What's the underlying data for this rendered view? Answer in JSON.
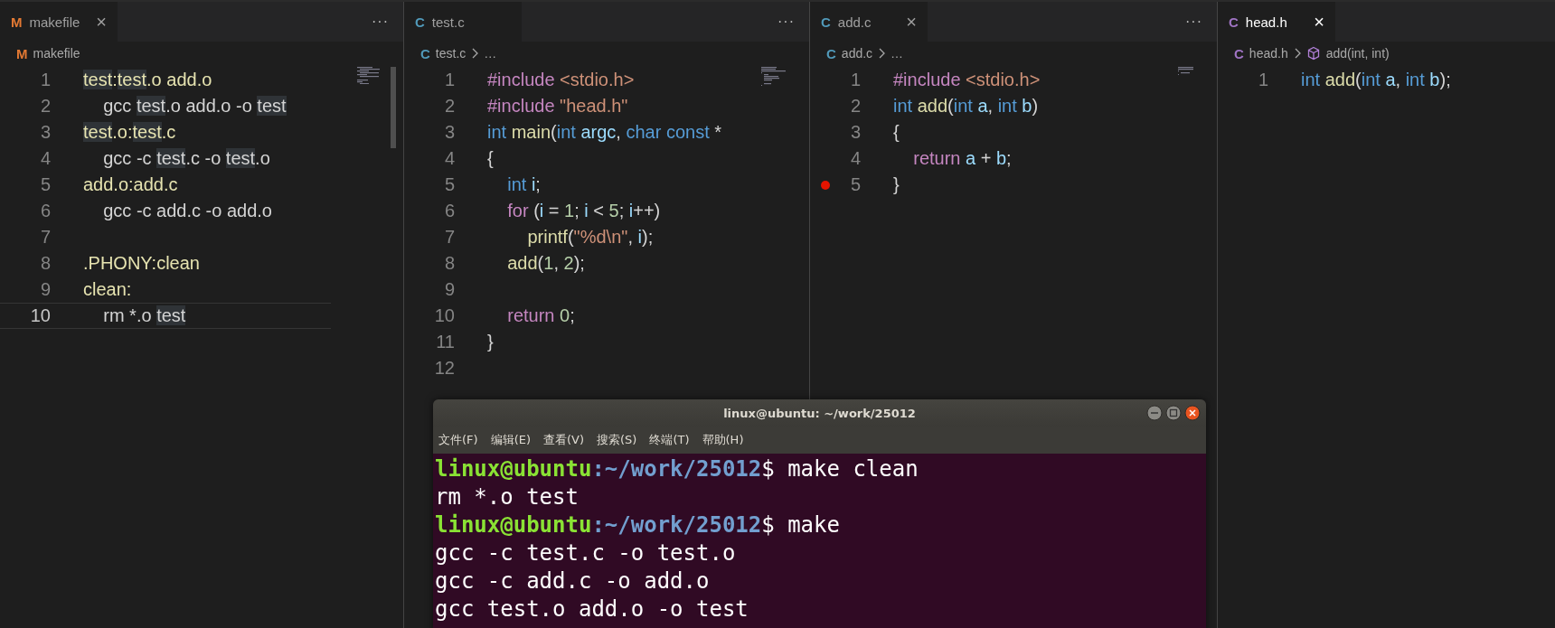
{
  "panes": [
    {
      "tab": {
        "icon": "M",
        "color": "#e37933",
        "label": "makefile",
        "selected": false,
        "close": "×"
      },
      "more": "···",
      "breadcrumb": [
        {
          "text": "makefile",
          "icon": "M",
          "color": "#e37933"
        }
      ],
      "lines": [
        {
          "number": "1",
          "tokens": [
            {
              "text": "test",
              "kind": "target",
              "highlight": true
            },
            {
              "text": ":",
              "kind": "target"
            },
            {
              "text": "test",
              "kind": "target",
              "highlight": true
            },
            {
              "text": ".o add.o",
              "kind": "target"
            }
          ]
        },
        {
          "number": "2",
          "tokens": [
            {
              "text": "    gcc ",
              "kind": "plain"
            },
            {
              "text": "test",
              "kind": "plain",
              "highlight": true
            },
            {
              "text": ".o add.o -o ",
              "kind": "plain"
            },
            {
              "text": "test",
              "kind": "plain",
              "highlight": true
            }
          ]
        },
        {
          "number": "3",
          "tokens": [
            {
              "text": "test",
              "kind": "target",
              "highlight": true
            },
            {
              "text": ".o:",
              "kind": "target"
            },
            {
              "text": "test",
              "kind": "target",
              "highlight": true
            },
            {
              "text": ".c",
              "kind": "target"
            }
          ]
        },
        {
          "number": "4",
          "tokens": [
            {
              "text": "    gcc -c ",
              "kind": "plain"
            },
            {
              "text": "test",
              "kind": "plain",
              "highlight": true
            },
            {
              "text": ".c -o ",
              "kind": "plain"
            },
            {
              "text": "test",
              "kind": "plain",
              "highlight": true
            },
            {
              "text": ".o",
              "kind": "plain"
            }
          ]
        },
        {
          "number": "5",
          "tokens": [
            {
              "text": "add.o:add.c",
              "kind": "target"
            }
          ]
        },
        {
          "number": "6",
          "tokens": [
            {
              "text": "    gcc -c add.c -o add.o",
              "kind": "plain"
            }
          ]
        },
        {
          "number": "7"
        },
        {
          "number": "8",
          "tokens": [
            {
              "text": ".PHONY:clean",
              "kind": "target"
            }
          ]
        },
        {
          "number": "9",
          "tokens": [
            {
              "text": "clean:",
              "kind": "target"
            }
          ]
        },
        {
          "number": "10",
          "current": true,
          "tokens": [
            {
              "text": "    rm *.o ",
              "kind": "plain"
            },
            {
              "text": "test",
              "kind": "plain",
              "highlight": true
            }
          ]
        }
      ]
    },
    {
      "tab": {
        "icon": "C",
        "color": "#519aba",
        "label": "test.c",
        "selected": false
      },
      "more": "···",
      "breadcrumb": [
        {
          "text": "test.c",
          "icon": "C",
          "color": "#519aba"
        },
        {
          "text": "…"
        }
      ],
      "lines": [
        {
          "number": "1",
          "tokens": [
            {
              "text": "#include ",
              "kind": "control"
            },
            {
              "text": "<stdio.h>",
              "kind": "string"
            }
          ]
        },
        {
          "number": "2",
          "tokens": [
            {
              "text": "#include ",
              "kind": "control"
            },
            {
              "text": "\"head.h\"",
              "kind": "string"
            }
          ]
        },
        {
          "number": "3",
          "tokens": [
            {
              "text": "int ",
              "kind": "keyword"
            },
            {
              "text": "main",
              "kind": "function"
            },
            {
              "text": "(",
              "kind": "plain"
            },
            {
              "text": "int ",
              "kind": "keyword"
            },
            {
              "text": "argc",
              "kind": "variable"
            },
            {
              "text": ", ",
              "kind": "plain"
            },
            {
              "text": "char const ",
              "kind": "keyword"
            },
            {
              "text": "*",
              "kind": "plain"
            }
          ]
        },
        {
          "number": "4",
          "tokens": [
            {
              "text": "{",
              "kind": "plain"
            }
          ]
        },
        {
          "number": "5",
          "tokens": [
            {
              "text": "    int ",
              "kind": "keyword"
            },
            {
              "text": "i",
              "kind": "variable"
            },
            {
              "text": ";",
              "kind": "plain"
            }
          ]
        },
        {
          "number": "6",
          "tokens": [
            {
              "text": "    for ",
              "kind": "control"
            },
            {
              "text": "(",
              "kind": "plain"
            },
            {
              "text": "i",
              "kind": "variable"
            },
            {
              "text": " = ",
              "kind": "plain"
            },
            {
              "text": "1",
              "kind": "number"
            },
            {
              "text": "; ",
              "kind": "plain"
            },
            {
              "text": "i",
              "kind": "variable"
            },
            {
              "text": " < ",
              "kind": "plain"
            },
            {
              "text": "5",
              "kind": "number"
            },
            {
              "text": "; ",
              "kind": "plain"
            },
            {
              "text": "i",
              "kind": "variable"
            },
            {
              "text": "++)",
              "kind": "plain"
            }
          ]
        },
        {
          "number": "7",
          "tokens": [
            {
              "text": "        printf",
              "kind": "function"
            },
            {
              "text": "(",
              "kind": "plain"
            },
            {
              "text": "\"%d\\n\"",
              "kind": "string"
            },
            {
              "text": ", ",
              "kind": "plain"
            },
            {
              "text": "i",
              "kind": "variable"
            },
            {
              "text": ");",
              "kind": "plain"
            }
          ]
        },
        {
          "number": "8",
          "tokens": [
            {
              "text": "    add",
              "kind": "function"
            },
            {
              "text": "(",
              "kind": "plain"
            },
            {
              "text": "1",
              "kind": "number"
            },
            {
              "text": ", ",
              "kind": "plain"
            },
            {
              "text": "2",
              "kind": "number"
            },
            {
              "text": ");",
              "kind": "plain"
            }
          ]
        },
        {
          "number": "9"
        },
        {
          "number": "10",
          "tokens": [
            {
              "text": "    return ",
              "kind": "control"
            },
            {
              "text": "0",
              "kind": "number"
            },
            {
              "text": ";",
              "kind": "plain"
            }
          ]
        },
        {
          "number": "11",
          "tokens": [
            {
              "text": "}",
              "kind": "plain"
            }
          ]
        },
        {
          "number": "12"
        }
      ]
    },
    {
      "tab": {
        "icon": "C",
        "color": "#519aba",
        "label": "add.c",
        "selected": false,
        "close": "×"
      },
      "more": "···",
      "breadcrumb": [
        {
          "text": "add.c",
          "icon": "C",
          "color": "#519aba"
        },
        {
          "text": "…"
        }
      ],
      "lines": [
        {
          "number": "1",
          "tokens": [
            {
              "text": "#include ",
              "kind": "control"
            },
            {
              "text": "<stdio.h>",
              "kind": "string"
            }
          ]
        },
        {
          "number": "2",
          "tokens": [
            {
              "text": "int ",
              "kind": "keyword"
            },
            {
              "text": "add",
              "kind": "function"
            },
            {
              "text": "(",
              "kind": "plain"
            },
            {
              "text": "int ",
              "kind": "keyword"
            },
            {
              "text": "a",
              "kind": "variable"
            },
            {
              "text": ", ",
              "kind": "plain"
            },
            {
              "text": "int ",
              "kind": "keyword"
            },
            {
              "text": "b",
              "kind": "variable"
            },
            {
              "text": ")",
              "kind": "plain"
            }
          ]
        },
        {
          "number": "3",
          "tokens": [
            {
              "text": "{",
              "kind": "plain"
            }
          ]
        },
        {
          "number": "4",
          "tokens": [
            {
              "text": "    return ",
              "kind": "control"
            },
            {
              "text": "a",
              "kind": "variable"
            },
            {
              "text": " + ",
              "kind": "plain"
            },
            {
              "text": "b",
              "kind": "variable"
            },
            {
              "text": ";",
              "kind": "plain"
            }
          ]
        },
        {
          "number": "5",
          "breakpoint": true,
          "tokens": [
            {
              "text": "}",
              "kind": "plain"
            }
          ]
        }
      ]
    },
    {
      "tab": {
        "icon": "C",
        "color": "#a074c4",
        "label": "head.h",
        "selected": true,
        "close": "×"
      },
      "breadcrumb": [
        {
          "text": "head.h",
          "icon": "C",
          "color": "#a074c4"
        },
        {
          "text": "add(int, int)",
          "symbol": true
        }
      ],
      "lines": [
        {
          "number": "1",
          "tokens": [
            {
              "text": "int ",
              "kind": "keyword"
            },
            {
              "text": "add",
              "kind": "function"
            },
            {
              "text": "(",
              "kind": "plain"
            },
            {
              "text": "int ",
              "kind": "keyword"
            },
            {
              "text": "a",
              "kind": "variable"
            },
            {
              "text": ", ",
              "kind": "plain"
            },
            {
              "text": "int ",
              "kind": "keyword"
            },
            {
              "text": "b",
              "kind": "variable"
            },
            {
              "text": ");",
              "kind": "plain"
            }
          ]
        }
      ]
    }
  ],
  "terminal": {
    "title": "linux@ubuntu: ~/work/25012",
    "menu": [
      "文件(F)",
      "编辑(E)",
      "查看(V)",
      "搜索(S)",
      "终端(T)",
      "帮助(H)"
    ],
    "lines": [
      {
        "kind": "prompt",
        "user": "linux@ubuntu",
        "path": ":~/work/25012",
        "command": "$ make clean"
      },
      {
        "kind": "output",
        "text": "rm *.o test"
      },
      {
        "kind": "prompt",
        "user": "linux@ubuntu",
        "path": ":~/work/25012",
        "command": "$ make"
      },
      {
        "kind": "output",
        "text": "gcc -c test.c -o test.o"
      },
      {
        "kind": "output",
        "text": "gcc -c add.c -o add.o"
      },
      {
        "kind": "output",
        "text": "gcc test.o add.o -o test"
      }
    ]
  }
}
